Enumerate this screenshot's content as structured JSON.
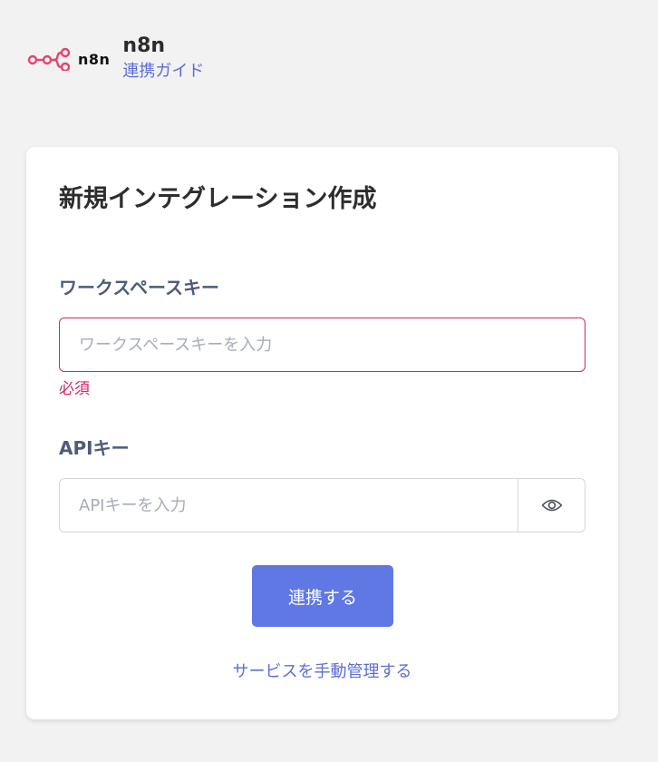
{
  "header": {
    "logo_text": "n8n",
    "app_name": "n8n",
    "guide_link": "連携ガイド"
  },
  "form": {
    "title": "新規インテグレーション作成",
    "workspace_key": {
      "label": "ワークスペースキー",
      "placeholder": "ワークスペースキーを入力",
      "value": "",
      "error": "必須"
    },
    "api_key": {
      "label": "APIキー",
      "placeholder": "APIキーを入力",
      "value": "",
      "toggle_icon": "eye-icon"
    },
    "submit_label": "連携する",
    "manual_link": "サービスを手動管理する"
  },
  "colors": {
    "accent": "#5f78e3",
    "link": "#5b6fd6",
    "error": "#d4246c",
    "logo": "#e8416b",
    "background": "#f2f2f2"
  }
}
